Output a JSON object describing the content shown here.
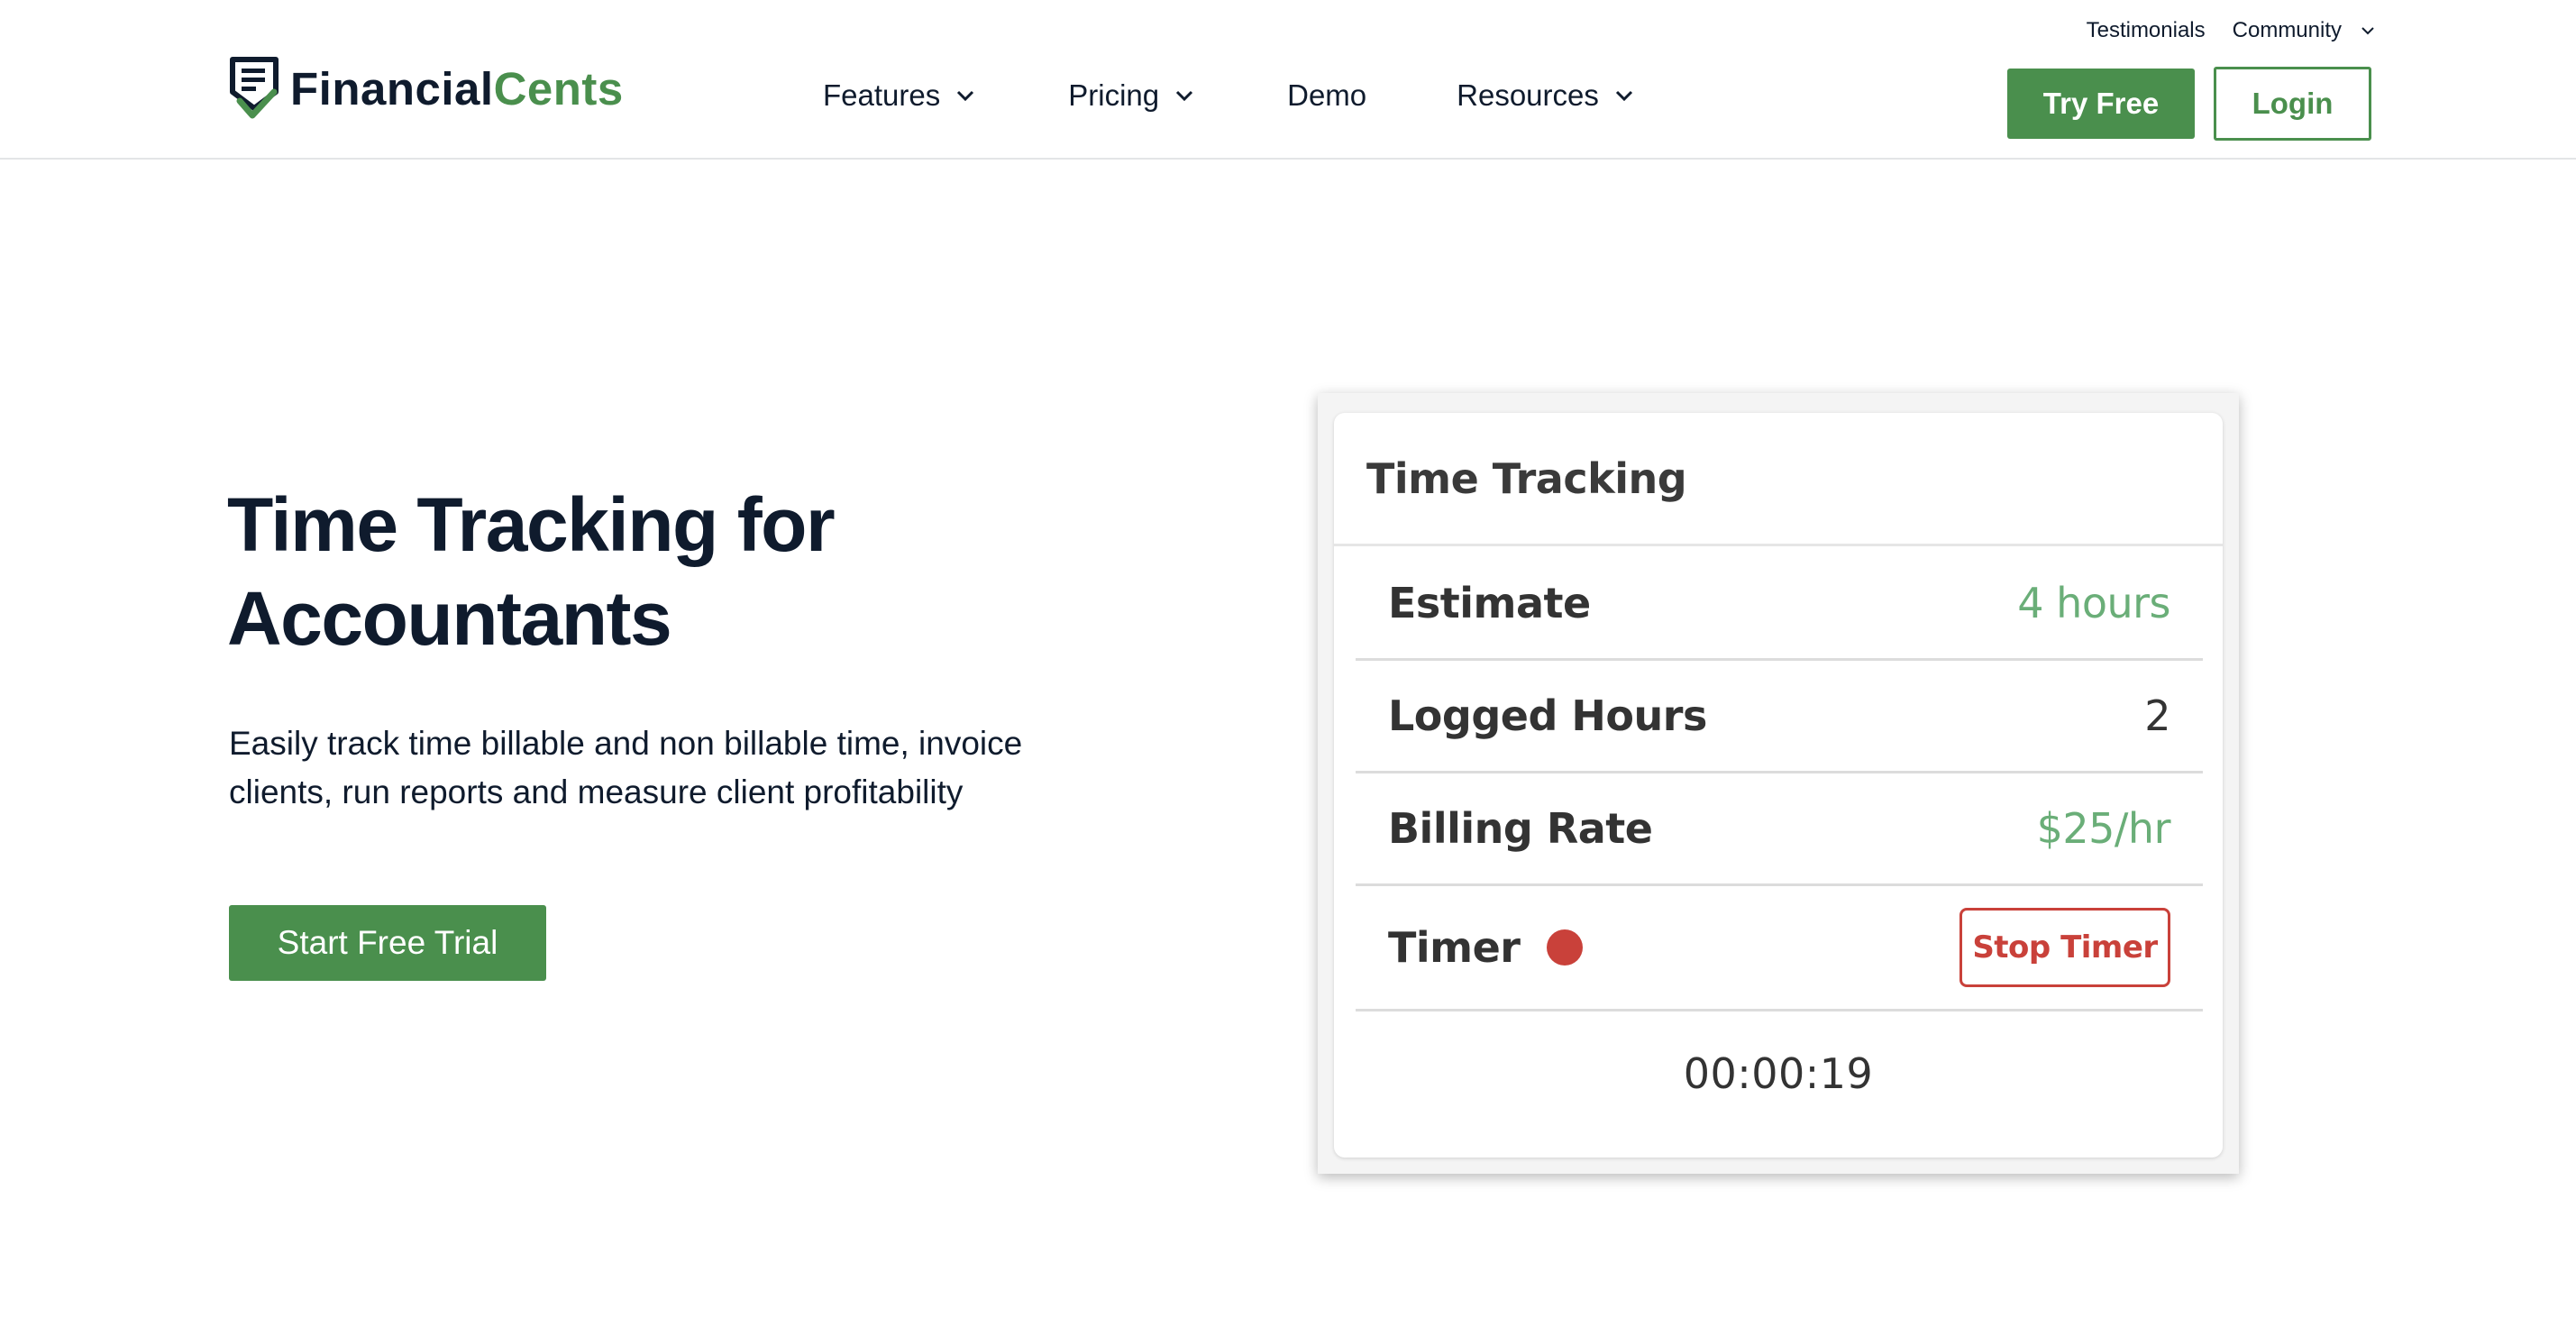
{
  "brand": {
    "name_part1": "Financial",
    "name_part2": "Cents",
    "primary_color": "#4a8f4d",
    "navy_color": "#0f1b2d"
  },
  "topbar": {
    "testimonials": "Testimonials",
    "community": "Community"
  },
  "nav": {
    "items": [
      {
        "label": "Features",
        "has_dropdown": true
      },
      {
        "label": "Pricing",
        "has_dropdown": true
      },
      {
        "label": "Demo",
        "has_dropdown": false
      },
      {
        "label": "Resources",
        "has_dropdown": true
      }
    ]
  },
  "header_buttons": {
    "try_free": "Try Free",
    "login": "Login"
  },
  "hero": {
    "title_line1": "Time Tracking for",
    "title_line2": "Accountants",
    "description_line1": "Easily track time billable and non billable time, invoice",
    "description_line2": "clients, run reports and measure client profitability",
    "cta": "Start Free Trial"
  },
  "card": {
    "title": "Time Tracking",
    "rows": [
      {
        "label": "Estimate",
        "value": "4 hours"
      },
      {
        "label": "Logged Hours",
        "value": "2"
      },
      {
        "label": "Billing Rate",
        "value": "$25/hr"
      }
    ],
    "timer_label": "Timer",
    "stop_button": "Stop Timer",
    "elapsed": "00:00:19",
    "timer_status_color": "#c9413a"
  }
}
